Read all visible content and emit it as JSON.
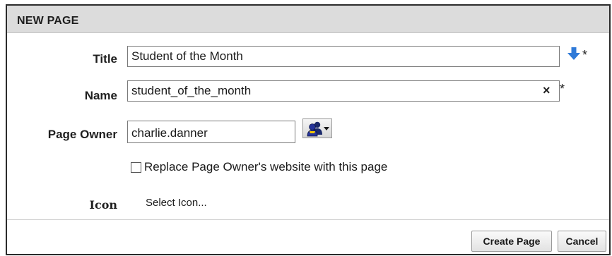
{
  "dialog": {
    "title": "NEW PAGE"
  },
  "form": {
    "title": {
      "label": "Title",
      "value": "Student of the Month",
      "required_marker": "*"
    },
    "name": {
      "label": "Name",
      "value": "student_of_the_month",
      "clear_glyph": "×",
      "required_marker": "*"
    },
    "page_owner": {
      "label": "Page Owner",
      "value": "charlie.danner"
    },
    "replace_checkbox": {
      "label": "Replace Page Owner's website with this page",
      "checked": false
    },
    "icon": {
      "label": "Icon",
      "link_text": "Select Icon..."
    }
  },
  "footer": {
    "create_label": "Create Page",
    "cancel_label": "Cancel"
  },
  "icons": {
    "title_action": "arrow-down-icon",
    "owner_picker": "user-picker-icon",
    "owner_picker_dropdown": "caret-down-icon"
  },
  "colors": {
    "header_bg": "#dcdcdc",
    "arrow_blue": "#2f7ad8",
    "border_dark": "#2b2b2b"
  }
}
